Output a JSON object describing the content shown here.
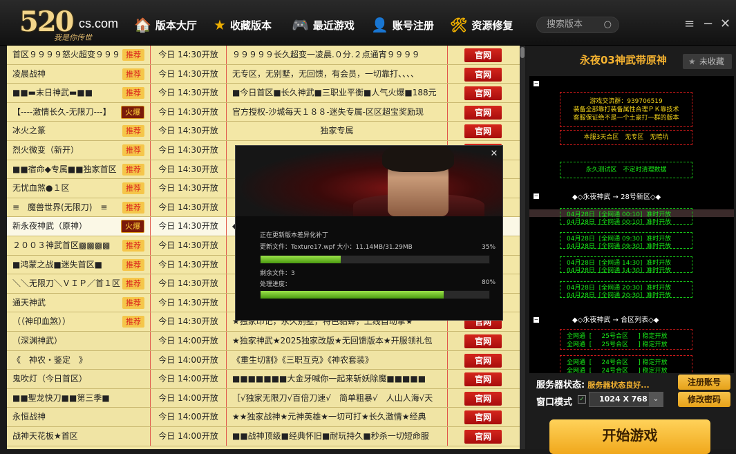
{
  "app": {
    "logo_main": "520",
    "logo_domain": "cs.com",
    "logo_slogan": "我是你传世",
    "nav": [
      {
        "label": "版本大厅",
        "icon": "home-icon",
        "glyph": "🏠"
      },
      {
        "label": "收藏版本",
        "icon": "star-icon",
        "glyph": "★"
      },
      {
        "label": "最近游戏",
        "icon": "gamepad-icon",
        "glyph": "🎮"
      },
      {
        "label": "账号注册",
        "icon": "user-add-icon",
        "glyph": "👤"
      },
      {
        "label": "资源修复",
        "icon": "tools-icon",
        "glyph": "🛠"
      }
    ],
    "search_placeholder": "搜索版本",
    "window_controls": [
      "≡",
      "−",
      "✕"
    ]
  },
  "list": {
    "rows": [
      {
        "name": "首区９９９９怒火超变９９９",
        "tag": "推荐",
        "time": "今日 14:30开放",
        "desc": "９９９９９长久超变一凌晨.０分.２点通宵９９９９",
        "action": "官网"
      },
      {
        "name": "凌晨战神",
        "tag": "推荐",
        "time": "今日 14:30开放",
        "desc": "无专区，无别墅，无回馈，有会员，一切靠打、、、、",
        "action": "官网"
      },
      {
        "name": "■■▬末日神武▬■■",
        "tag": "推荐",
        "time": "今日 14:30开放",
        "desc": "■今日首区■长久神武■三职业平衡■人气火爆■188元",
        "action": "官网"
      },
      {
        "name": "【----激情长久-无限刀---】",
        "tag": "火爆",
        "time": "今日 14:30开放",
        "desc": "官方授权-沙城每天１８８-迷失专属-区区超宝奖励现",
        "action": "官网"
      },
      {
        "name": "冰火之篆",
        "tag": "推荐",
        "time": "今日 14:30开放",
        "desc": "独家专属",
        "action": "官网"
      },
      {
        "name": "烈火微变（新开）",
        "tag": "推荐",
        "time": "今日 14:30开放",
        "desc": "",
        "action": "官网"
      },
      {
        "name": "■■宿命◆专属■■独家首区",
        "tag": "推荐",
        "time": "今日 14:30开放",
        "desc": "",
        "action": "官网"
      },
      {
        "name": "无忧血煞●１区",
        "tag": "推荐",
        "time": "今日 14:30开放",
        "desc": "",
        "action": "官网"
      },
      {
        "name": "≡　魔兽世界(无限刀)　≡",
        "tag": "推荐",
        "time": "今日 14:30开放",
        "desc": "",
        "action": "官网"
      },
      {
        "name": "新永夜神武（原神）",
        "tag": "火爆",
        "time": "今日 14:30开放",
        "desc": "◆",
        "action": "官网"
      },
      {
        "name": "２００３神武首区▩▩▩▩",
        "tag": "推荐",
        "time": "今日 14:30开放",
        "desc": "",
        "action": "官网"
      },
      {
        "name": "■鸿蒙之战■迷失首区■",
        "tag": "推荐",
        "time": "今日 14:30开放",
        "desc": "",
        "action": "官网"
      },
      {
        "name": "＼＼无限刀＼ＶＩＰ／首１区",
        "tag": "推荐",
        "time": "今日 14:30开放",
        "desc": "",
        "action": "官网"
      },
      {
        "name": "通天神武",
        "tag": "推荐",
        "time": "今日 14:30开放",
        "desc": "",
        "action": "官网"
      },
      {
        "name": "（（神印血煞））",
        "tag": "推荐",
        "time": "今日 14:30开放",
        "desc": "★独家印记，永久别墅，特色貂蝉，上线自动拿★",
        "action": "官网"
      },
      {
        "name": "（深渊神武）",
        "tag": "",
        "time": "今日 14:00开放",
        "desc": "★独家神武★2025独家改版★无回馈版本★开服领礼包",
        "action": "官网"
      },
      {
        "name": "《　神农・鉴定　》",
        "tag": "",
        "time": "今日 14:00开放",
        "desc": "《重生切割》《三职互克》《神农套装》",
        "action": "官网"
      },
      {
        "name": "鬼吹灯（今日首区）",
        "tag": "",
        "time": "今日 14:00开放",
        "desc": "■■■■■■■大金牙喊你一起来斩妖除魔■■■■■",
        "action": "官网"
      },
      {
        "name": "■■聖龙快刀■■第三季■",
        "tag": "",
        "time": "今日 14:00开放",
        "desc": "［√独家无限刀√百倍刀速√　简单粗暴√　人山人海√天",
        "action": "官网"
      },
      {
        "name": "永恒战神",
        "tag": "",
        "time": "今日 14:00开放",
        "desc": "★★独家战神★元神英雄★一切可打★长久激情★经典",
        "action": "官网"
      },
      {
        "name": "战神天花板★首区",
        "tag": "",
        "time": "今日 14:00开放",
        "desc": "■■战神顶级■经典怀旧■耐玩持久■秒杀一切短命服",
        "action": "官网"
      }
    ]
  },
  "right": {
    "title": "永夜03神武带原神",
    "fav_label": "未收藏",
    "info_lines": [
      "游戏交流群：939706519",
      "装备全部靠打装备属性合理ＰＫ靠技术",
      "客服保证绝不是一个土豪打一群的版本"
    ],
    "info2": "本服3天合区　无专区　无暗坑",
    "info3": "永久测试区　不定时清理数据",
    "section1": "◆◇永夜神武 → 28号新区◇◆",
    "schedule": [
      "04月28日  [全网通 00:10]  准时开放",
      "04月28日  [全网通 00:10]  准时开放",
      "04月28日  [全网通 09:30]  准时开放",
      "04月28日  [全网通 09:30]  准时开放",
      "04月28日  [全网通 14:30]  准时开放",
      "04月28日  [全网通 14:30]  准时开放",
      "04月28日  [全网通 20:30]  准时开放",
      "04月28日  [全网通 20:30]  准时开放"
    ],
    "section2": "◆◇永夜神武 → 合区列表◇◆",
    "merge": [
      "全网通  [     25号合区     ] 稳定开放",
      "全网通  [     25号合区     ] 稳定开放",
      "全网通  [     24号合区     ] 稳定开放",
      "全网通  [     24号合区     ] 稳定开放"
    ],
    "status_label": "服务器状态:",
    "status_value": "服务器状态良好...",
    "window_mode_label": "窗口模式",
    "window_mode_checked": "✓",
    "resolution": "1024 X 768",
    "register_label": "注册账号",
    "password_label": "修改密码",
    "start_label": "开始游戏"
  },
  "dialog": {
    "close": "✕",
    "updating": "正在更新版本差异化补丁",
    "file_label": "更新文件：Texture17.wpf 大小：11.14MB/31.29MB",
    "file_percent": "35%",
    "file_progress": 0.35,
    "remaining": "剩余文件：3",
    "overall_label": "处理进度：",
    "overall_percent": "80%",
    "overall_progress": 0.8
  }
}
